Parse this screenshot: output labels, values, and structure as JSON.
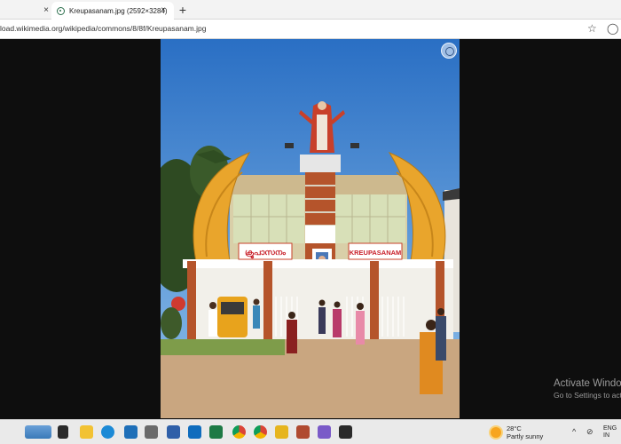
{
  "browser": {
    "tabs": [
      {
        "label": ""
      },
      {
        "label": "Kreupasanam.jpg (2592×3284)"
      }
    ],
    "new_tab": "+",
    "close_glyph": "×",
    "url": "load.wikimedia.org/wikipedia/commons/8/8f/Kreupasanam.jpg"
  },
  "photo": {
    "sign_left": "ക്രൂപാസനം",
    "sign_right": "KREUPASANAM"
  },
  "watermark": {
    "line1": "Activate Windo",
    "line2": "Go to Settings to act"
  },
  "taskbar": {
    "weather_temp": "28°C",
    "weather_desc": "Partly sunny",
    "lang_line1": "ENG",
    "lang_line2": "IN"
  },
  "colors": {
    "sky": "#2f7dd0",
    "building_brick": "#b5542b",
    "wing_gold": "#e9a52c",
    "ground": "#c9a680"
  }
}
